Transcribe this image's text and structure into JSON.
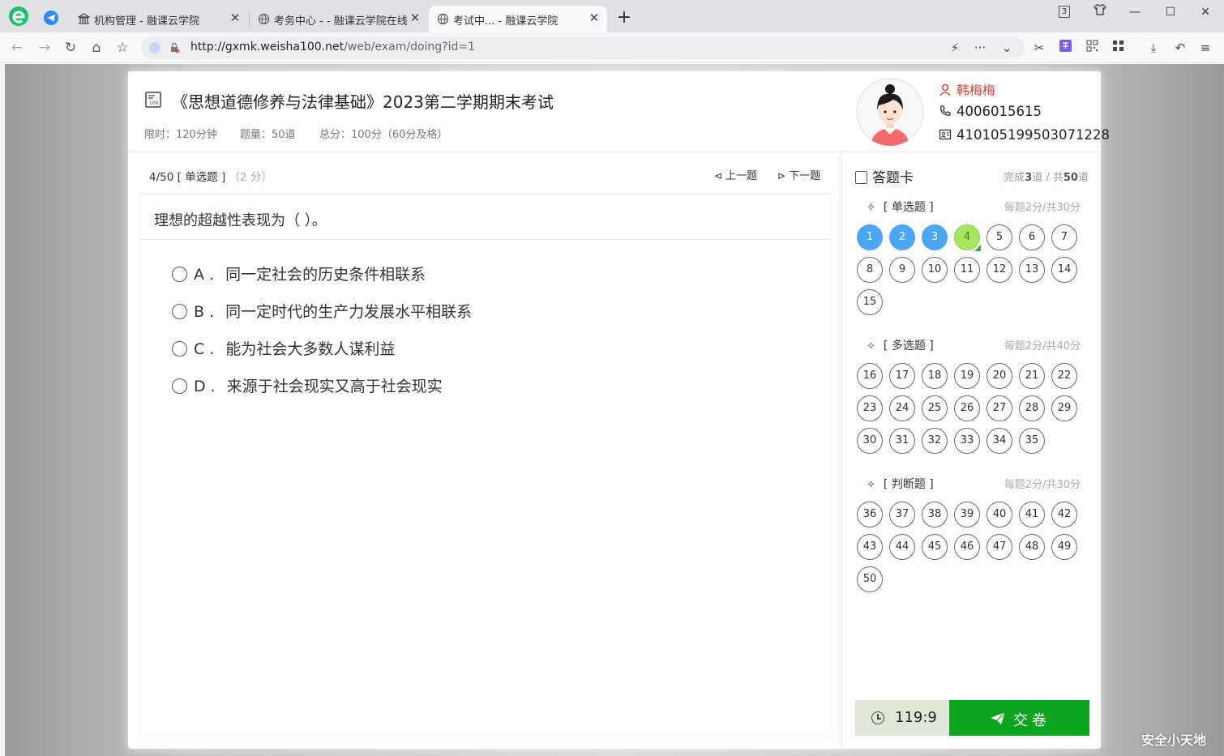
{
  "browser": {
    "tabs": [
      {
        "title": "机构管理 - 融课云学院",
        "icon": "bank-icon"
      },
      {
        "title": "考务中心 - - 融课云学院在线考",
        "icon": "globe-icon"
      },
      {
        "title": "考试中... - 融课云学院",
        "icon": "globe-icon"
      }
    ],
    "tab_count_badge": "3",
    "new_tab": "+",
    "url_host": "http://gxmk.weisha100.net",
    "url_path": "/web/exam/doing?id=1"
  },
  "exam": {
    "title": "《思想道德修养与法律基础》2023第二学期期末考试",
    "time_limit": "限时：120分钟",
    "question_count": "题量：50道",
    "total_score": "总分：100分（60分及格）"
  },
  "user": {
    "name": "韩梅梅",
    "phone": "4006015615",
    "id_number": "410105199503071228"
  },
  "question": {
    "index": "4/50",
    "type": "[ 单选题 ]",
    "score": "（2 分）",
    "prev": "上一题",
    "next": "下一题",
    "text": "理想的超越性表现为（ ）。",
    "options": [
      {
        "letter": "A .",
        "text": "同一定社会的历史条件相联系"
      },
      {
        "letter": "B .",
        "text": "同一定时代的生产力发展水平相联系"
      },
      {
        "letter": "C .",
        "text": "能为社会大多数人谋利益"
      },
      {
        "letter": "D .",
        "text": "来源于社会现实又高于社会现实"
      }
    ]
  },
  "answer_card": {
    "title": "答题卡",
    "progress_prefix": "完成",
    "completed": "3",
    "progress_mid": "道 / 共",
    "total": "50",
    "progress_suffix": "道",
    "sections": [
      {
        "title": "[ 单选题 ]",
        "score": "每题2分/共30分",
        "numbers": [
          "1",
          "2",
          "3",
          "4",
          "5",
          "6",
          "7",
          "8",
          "9",
          "10",
          "11",
          "12",
          "13",
          "14",
          "15"
        ]
      },
      {
        "title": "[ 多选题 ]",
        "score": "每题2分/共40分",
        "numbers": [
          "16",
          "17",
          "18",
          "19",
          "20",
          "21",
          "22",
          "23",
          "24",
          "25",
          "26",
          "27",
          "28",
          "29",
          "30",
          "31",
          "32",
          "33",
          "34",
          "35"
        ]
      },
      {
        "title": "[ 判断题 ]",
        "score": "每题2分/共30分",
        "numbers": [
          "36",
          "37",
          "38",
          "39",
          "40",
          "41",
          "42",
          "43",
          "44",
          "45",
          "46",
          "47",
          "48",
          "49",
          "50"
        ]
      }
    ],
    "answered": [
      "1",
      "2",
      "3"
    ],
    "current": "4"
  },
  "timer": "119:9",
  "submit_label": "交卷",
  "watermark": "安全小天地",
  "colors": {
    "answered": "#4da6f4",
    "current": "#a5e65a",
    "submit": "#0aa51c",
    "user_name": "#e2453c"
  }
}
